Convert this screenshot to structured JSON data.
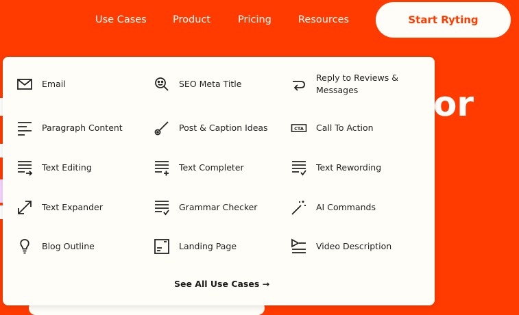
{
  "nav": {
    "links": [
      "Use Cases",
      "Product",
      "Pricing",
      "Resources"
    ],
    "cta_label": "Start Ryting"
  },
  "hero": {
    "fragment": "or"
  },
  "dropdown": {
    "items": [
      {
        "label": "Email",
        "icon": "mail-icon"
      },
      {
        "label": "SEO Meta Title",
        "icon": "search-face-icon"
      },
      {
        "label": "Reply to Reviews & Messages",
        "icon": "reply-icon"
      },
      {
        "label": "Paragraph Content",
        "icon": "paragraph-icon"
      },
      {
        "label": "Post & Caption Ideas",
        "icon": "magic-wand-icon"
      },
      {
        "label": "Call To Action",
        "icon": "cta-icon"
      },
      {
        "label": "Text Editing",
        "icon": "text-editing-icon"
      },
      {
        "label": "Text Completer",
        "icon": "text-completer-icon"
      },
      {
        "label": "Text Rewording",
        "icon": "text-rewording-icon"
      },
      {
        "label": "Text Expander",
        "icon": "expand-arrow-icon"
      },
      {
        "label": "Grammar Checker",
        "icon": "grammar-check-icon"
      },
      {
        "label": "AI Commands",
        "icon": "sparkle-wand-icon"
      },
      {
        "label": "Blog Outline",
        "icon": "lightbulb-icon"
      },
      {
        "label": "Landing Page",
        "icon": "landing-page-icon"
      },
      {
        "label": "Video Description",
        "icon": "video-description-icon"
      }
    ],
    "see_all": "See All Use Cases →"
  },
  "colors": {
    "brand": "#ff3b00",
    "panel": "#fffdf7",
    "text": "#222222"
  }
}
